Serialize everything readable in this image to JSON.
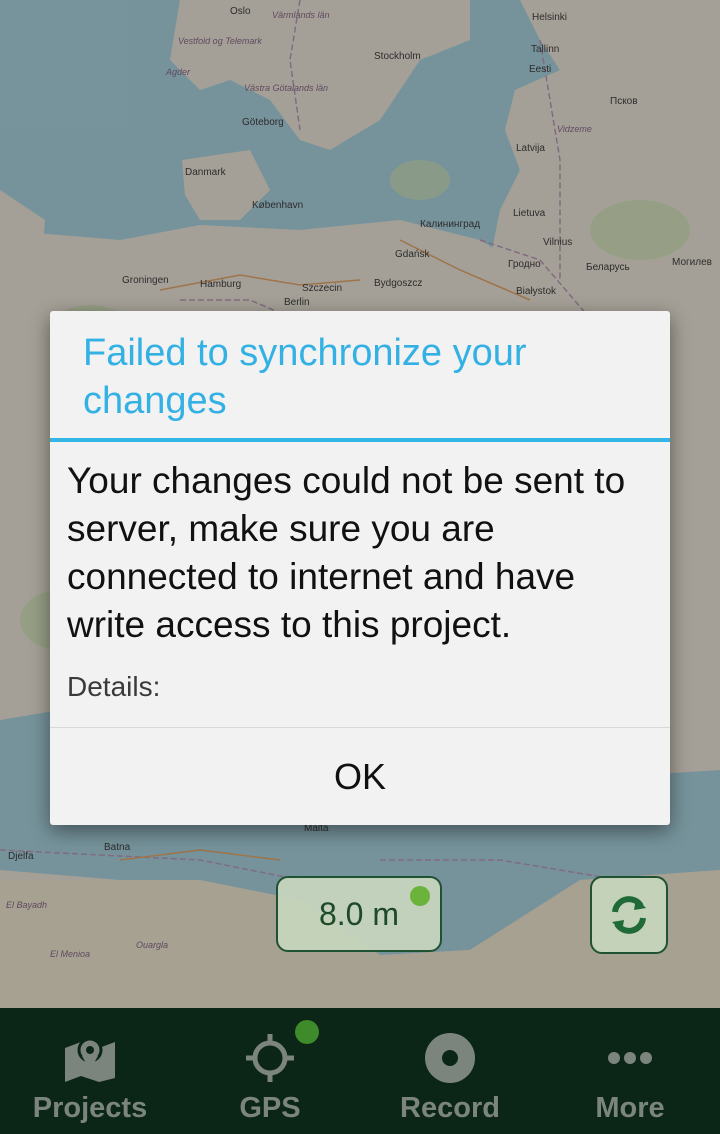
{
  "map": {
    "labels": [
      {
        "text": "Oslo",
        "cls": ""
      },
      {
        "text": "Värmlands län",
        "cls": "it"
      },
      {
        "text": "Helsinki",
        "cls": ""
      },
      {
        "text": "Vestfold og Telemark",
        "cls": "it"
      },
      {
        "text": "Stockholm",
        "cls": ""
      },
      {
        "text": "Tallinn",
        "cls": ""
      },
      {
        "text": "Agder",
        "cls": "it"
      },
      {
        "text": "Eesti",
        "cls": ""
      },
      {
        "text": "Västra Götalands län",
        "cls": "it"
      },
      {
        "text": "Псков",
        "cls": ""
      },
      {
        "text": "Göteborg",
        "cls": ""
      },
      {
        "text": "Vidzeme",
        "cls": "it"
      },
      {
        "text": "Latvija",
        "cls": ""
      },
      {
        "text": "Danmark",
        "cls": ""
      },
      {
        "text": "København",
        "cls": ""
      },
      {
        "text": "Lietuva",
        "cls": ""
      },
      {
        "text": "Калининград",
        "cls": ""
      },
      {
        "text": "Vilnius",
        "cls": ""
      },
      {
        "text": "Gdańsk",
        "cls": ""
      },
      {
        "text": "Гродно",
        "cls": ""
      },
      {
        "text": "Беларусь",
        "cls": ""
      },
      {
        "text": "Groningen",
        "cls": ""
      },
      {
        "text": "Hamburg",
        "cls": ""
      },
      {
        "text": "Szczecin",
        "cls": ""
      },
      {
        "text": "Bydgoszcz",
        "cls": ""
      },
      {
        "text": "Białystok",
        "cls": ""
      },
      {
        "text": "Berlin",
        "cls": ""
      },
      {
        "text": "Malta",
        "cls": ""
      },
      {
        "text": "Batna",
        "cls": ""
      },
      {
        "text": "Djelfa",
        "cls": ""
      },
      {
        "text": "El Bayadh",
        "cls": "it"
      },
      {
        "text": "Ouargla",
        "cls": "it"
      },
      {
        "text": "El Menioa",
        "cls": "it"
      },
      {
        "text": "Могилев",
        "cls": ""
      }
    ]
  },
  "dialog": {
    "title": "Failed to synchronize your changes",
    "message": "Your changes could not be sent to server, make sure you are connected to internet and have write access to this project.",
    "details_label": "Details:",
    "ok_label": "OK"
  },
  "map_controls": {
    "gps_accuracy": "8.0 m"
  },
  "nav": {
    "items": [
      {
        "label": "Projects",
        "icon": "map-pin-icon"
      },
      {
        "label": "GPS",
        "icon": "crosshair-icon"
      },
      {
        "label": "Record",
        "icon": "record-icon"
      },
      {
        "label": "More",
        "icon": "more-dots-icon"
      }
    ]
  },
  "colors": {
    "accent": "#33b5e5",
    "nav_background": "#0b2616",
    "gps_dot": "#6cb33c"
  }
}
